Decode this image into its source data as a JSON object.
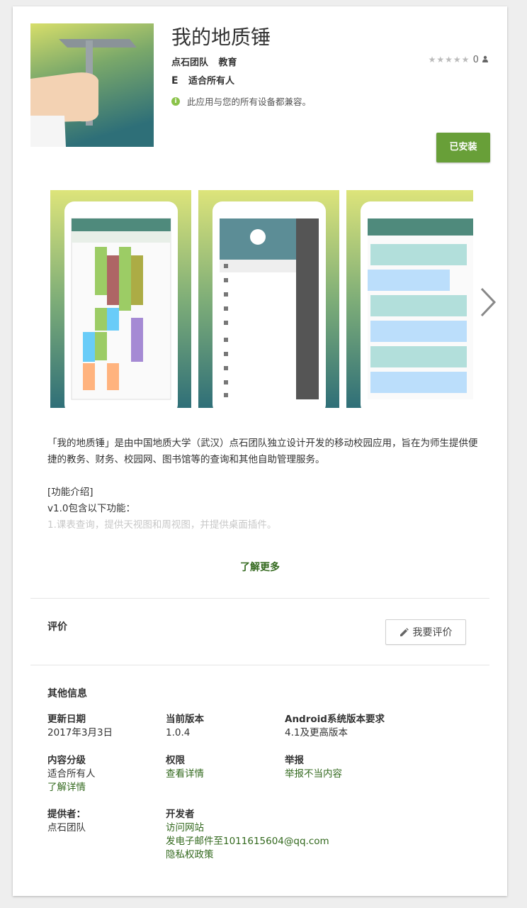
{
  "app": {
    "title": "我的地质锤",
    "developer": "点石团队",
    "category": "教育",
    "rating_count": "0",
    "content_rating": "适合所有人",
    "compatibility": "此应用与您的所有设备都兼容。",
    "install_button": "已安装"
  },
  "colors": {
    "accent": "#689f38",
    "link": "#33691e",
    "compat_icon": "#8bc34a"
  },
  "description": {
    "p1": "「我的地质锤」是由中国地质大学（武汉）点石团队独立设计开发的移动校园应用，旨在为师生提供便捷的教务、财务、校园网、图书馆等的查询和其他自助管理服务。",
    "features_header": "[功能介绍]",
    "version_line": "v1.0包含以下功能：",
    "faded_line": "1.课表查询，提供天视图和周视图，并提供桌面插件。",
    "learn_more": "了解更多"
  },
  "reviews": {
    "heading": "评价",
    "write_button": "我要评价"
  },
  "info": {
    "heading": "其他信息",
    "updated_label": "更新日期",
    "updated_value": "2017年3月3日",
    "version_label": "当前版本",
    "version_value": "1.0.4",
    "android_label": "Android系统版本要求",
    "android_value": "4.1及更高版本",
    "rating_label": "内容分级",
    "rating_value": "适合所有人",
    "rating_link": "了解详情",
    "perm_label": "权限",
    "perm_link": "查看详情",
    "report_label": "举报",
    "report_link": "举报不当内容",
    "provider_label": "提供者：",
    "provider_value": "点石团队",
    "dev_label": "开发者",
    "dev_website": "访问网站",
    "dev_email": "发电子邮件至1011615604@qq.com",
    "dev_privacy": "隐私权政策"
  },
  "icons": [
    "rock-hammer-app-icon",
    "star-icon",
    "person-icon",
    "e-rating-icon",
    "info-icon",
    "chevron-right-icon",
    "pencil-icon"
  ]
}
